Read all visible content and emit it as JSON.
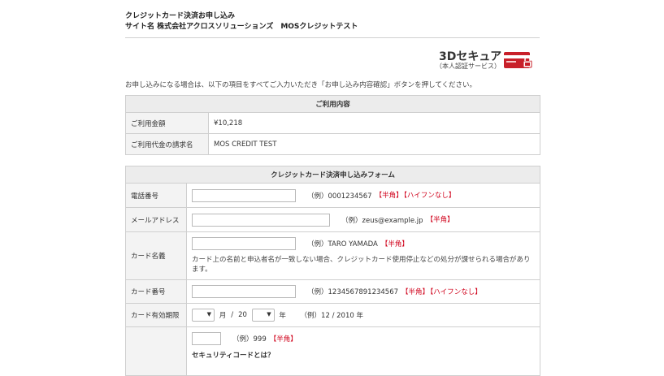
{
  "header": {
    "line1": "クレジットカード決済お申し込み",
    "line2": "サイト名 株式会社アクロスソリューションズ　MOSクレジットテスト"
  },
  "secure": {
    "title": "3Dセキュア",
    "subtitle": "（本人認証サービス）"
  },
  "intro": "お申し込みになる場合は、以下の項目をすべてご入力いただき「お申し込み内容確認」ボタンを押してください。",
  "usage": {
    "heading": "ご利用内容",
    "rows": [
      {
        "label": "ご利用金額",
        "value": "¥10,218"
      },
      {
        "label": "ご利用代金の請求名",
        "value": "MOS CREDIT TEST"
      }
    ]
  },
  "form": {
    "heading": "クレジットカード決済申し込みフォーム",
    "phone": {
      "label": "電話番号",
      "example": "（例）0001234567",
      "tag1": "【半角】",
      "tag2": "【ハイフンなし】"
    },
    "email": {
      "label": "メールアドレス",
      "example": "（例）zeus@example.jp",
      "tag1": "【半角】"
    },
    "name": {
      "label": "カード名義",
      "example": "（例）TARO YAMADA",
      "tag1": "【半角】",
      "note": "カード上の名前と申込者名が一致しない場合、クレジットカード使用停止などの処分が課せられる場合があります。"
    },
    "number": {
      "label": "カード番号",
      "example": "（例）1234567891234567",
      "tag1": "【半角】",
      "tag2": "【ハイフンなし】"
    },
    "expiry": {
      "label": "カード有効期限",
      "month_unit": "月",
      "slash": "/",
      "year_prefix": "20",
      "year_unit": "年",
      "example": "（例）12 / 2010 年"
    },
    "cvv": {
      "example": "（例）999",
      "tag1": "【半角】",
      "caption": "セキュリティコードとは？"
    }
  },
  "colors": {
    "accent_red": "#d0021b",
    "header_bg": "#ececec",
    "label_bg": "#f3f3f3",
    "card_red": "#c8202a"
  }
}
